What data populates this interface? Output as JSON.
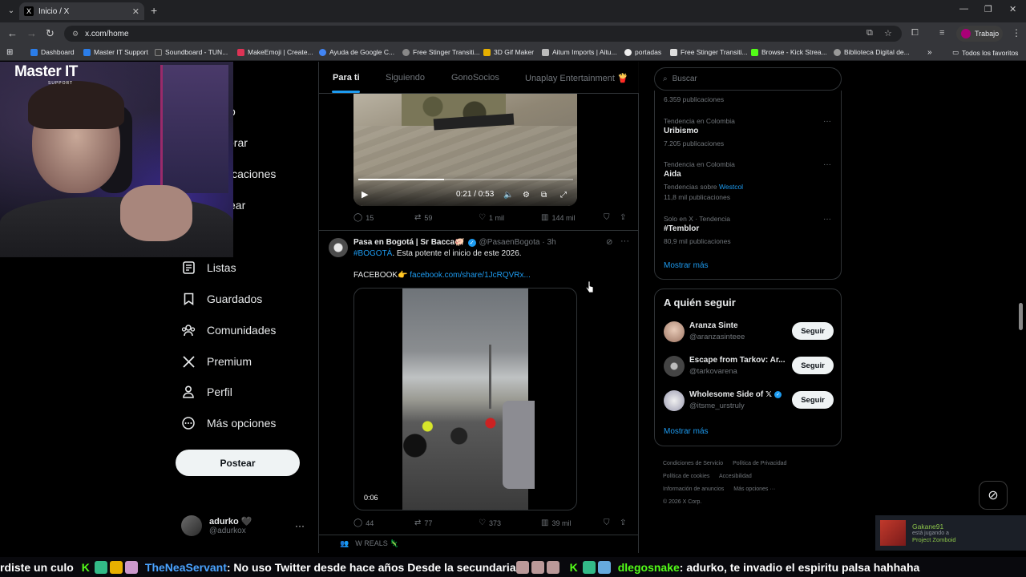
{
  "browser": {
    "tab_title": "Inicio / X",
    "tab_favicon": "X",
    "url": "x.com/home",
    "profile_label": "Trabajo",
    "bookmarks": [
      {
        "label": "Dashboard",
        "color": "#2b7de9"
      },
      {
        "label": "Master IT Support",
        "color": "#2b7de9"
      },
      {
        "label": "Soundboard - TUN...",
        "color": "#3a3a3a"
      },
      {
        "label": "MakeEmoji | Create...",
        "color": "#d35"
      },
      {
        "label": "Ayuda de Google C...",
        "color": "#4285f4"
      },
      {
        "label": "Free Stinger Transiti...",
        "color": "#888"
      },
      {
        "label": "3D Gif Maker",
        "color": "#e7b000"
      },
      {
        "label": "Aitum Imports | Aitu...",
        "color": "#bbb"
      },
      {
        "label": "portadas",
        "color": "#eee"
      },
      {
        "label": "Free Stinger Transiti...",
        "color": "#ddd"
      },
      {
        "label": "Browse - Kick Strea...",
        "color": "#53fc18"
      },
      {
        "label": "Biblioteca Digital de...",
        "color": "#999"
      }
    ],
    "all_bookmarks_label": "Todos los favoritos"
  },
  "leftnav": {
    "partial_items": [
      "o",
      "orar",
      "ificaciones",
      "ear"
    ],
    "items": [
      {
        "label": "Listas",
        "icon": "list-icon"
      },
      {
        "label": "Guardados",
        "icon": "bookmark-icon"
      },
      {
        "label": "Comunidades",
        "icon": "communities-icon"
      },
      {
        "label": "Premium",
        "icon": "x-logo-icon"
      },
      {
        "label": "Perfil",
        "icon": "profile-icon"
      },
      {
        "label": "Más opciones",
        "icon": "more-options-icon"
      }
    ],
    "post_button": "Postear",
    "account": {
      "name": "adurko 🖤",
      "handle": "@adurkox"
    }
  },
  "webcam": {
    "logo": "Master IT",
    "logo_sub": "SUPPORT"
  },
  "timeline": {
    "tabs": [
      "Para ti",
      "Siguiendo",
      "GonoSocios",
      "Unaplay Entertainment 🍟"
    ],
    "active_tab": 0,
    "video1": {
      "time": "0:21 / 0:53",
      "progress": 0.4
    },
    "tweet1_actions": {
      "replies": "15",
      "reposts": "59",
      "likes": "1 mil",
      "views": "144 mil"
    },
    "tweet2": {
      "name": "Pasa en Bogotá | Sr Bacca🐖",
      "handle": "@PasaenBogota",
      "time": "· 3h",
      "hashtag": "#BOGOTÁ",
      "text": ". Esta potente el inicio de este 2026.",
      "facebook_label": "FACEBOOK👉",
      "facebook_link": "facebook.com/share/1JcRQVRx...",
      "video_duration": "0:06",
      "actions": {
        "replies": "44",
        "reposts": "77",
        "likes": "373",
        "views": "39 mil"
      }
    },
    "next_label": "W REALS 🦎"
  },
  "right": {
    "search_placeholder": "Buscar",
    "trends": [
      {
        "meta": "6.359 publicaciones",
        "title": "",
        "sub": ""
      },
      {
        "meta": "Tendencia en Colombia",
        "title": "Uribismo",
        "sub": "7.205 publicaciones"
      },
      {
        "meta": "Tendencia en Colombia",
        "title": "Aida",
        "sub_prefix": "Tendencias sobre ",
        "sub_link": "Westcol",
        "sub2": "11,8 mil publicaciones"
      },
      {
        "meta": "Solo en X · Tendencia",
        "title": "#Temblor",
        "sub": "80,9 mil publicaciones"
      }
    ],
    "show_more": "Mostrar más",
    "who_to_follow": {
      "title": "A quién seguir",
      "follow_label": "Seguir",
      "accounts": [
        {
          "name": "Aranza Sinte",
          "handle": "@aranzasinteee",
          "verified": false,
          "color": "#c9a08d"
        },
        {
          "name": "Escape from Tarkov: Ar...",
          "handle": "@tarkovarena",
          "verified": false,
          "color": "#555"
        },
        {
          "name": "Wholesome Side of 𝕏",
          "handle": "@itsme_urstruly",
          "verified": true,
          "color": "#ddd"
        }
      ],
      "show_more": "Mostrar más"
    },
    "footer": [
      "Condiciones de Servicio",
      "Política de Privacidad",
      "Política de cookies",
      "Accesibilidad",
      "Información de anuncios",
      "Más opciones ···",
      "© 2026 X Corp."
    ]
  },
  "notification": {
    "user": "Gakane91",
    "status": "está jugando a",
    "game": "Project Zomboid"
  },
  "ticker": {
    "seg1": "rdiste un culo",
    "user1": "TheNeaServant",
    "msg1": ": No uso Twitter desde hace años  Desde la secundaria",
    "user2": "dlegosnake",
    "msg2": ": adurko, te invadio el espiritu palsa  hahhaha"
  }
}
